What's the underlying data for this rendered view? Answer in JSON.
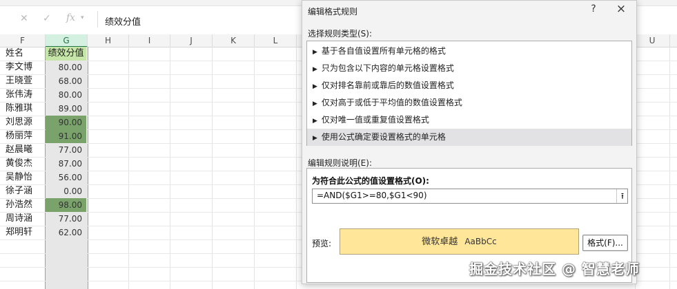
{
  "formula_bar": {
    "cancel_icon": "close-icon",
    "enter_icon": "check-icon",
    "fx_label": "fx",
    "content": "绩效分值"
  },
  "columns": {
    "left": [
      "F",
      "G",
      "H",
      "I",
      "J",
      "K",
      "L"
    ],
    "right": [
      "U"
    ]
  },
  "sheet": {
    "header_name": "姓名",
    "header_score": "绩效分值",
    "rows": [
      {
        "name": "李文博",
        "score": "80.00",
        "highlight": false
      },
      {
        "name": "王晓萱",
        "score": "68.00",
        "highlight": false
      },
      {
        "name": "张伟涛",
        "score": "80.00",
        "highlight": false
      },
      {
        "name": "陈雅琪",
        "score": "89.00",
        "highlight": false
      },
      {
        "name": "刘思源",
        "score": "90.00",
        "highlight": true
      },
      {
        "name": "杨丽萍",
        "score": "91.00",
        "highlight": true
      },
      {
        "name": "赵晨曦",
        "score": "77.00",
        "highlight": false
      },
      {
        "name": "黄俊杰",
        "score": "87.00",
        "highlight": false
      },
      {
        "name": "吴静怡",
        "score": "56.00",
        "highlight": false
      },
      {
        "name": "徐子涵",
        "score": "0.00",
        "highlight": false
      },
      {
        "name": "孙浩然",
        "score": "98.00",
        "highlight": true
      },
      {
        "name": "周诗涵",
        "score": "77.00",
        "highlight": false
      },
      {
        "name": "郑明轩",
        "score": "62.00",
        "highlight": false
      }
    ]
  },
  "dialog": {
    "title": "编辑格式规则",
    "help": "?",
    "close": "×",
    "rule_type_label": "选择规则类型(S):",
    "rule_types": [
      "基于各自值设置所有单元格的格式",
      "只为包含以下内容的单元格设置格式",
      "仅对排名靠前或靠后的数值设置格式",
      "仅对高于或低于平均值的数值设置格式",
      "仅对唯一值或重复值设置格式",
      "使用公式确定要设置格式的单元格"
    ],
    "selected_rule_index": 5,
    "description_label": "编辑规则说明(E):",
    "formula_label": "为符合此公式的值设置格式(O):",
    "formula_value": "=AND($G1>=80,$G1<90)",
    "collapse_icon": "collapse-dialog-icon",
    "preview_label": "预览:",
    "preview_text": "微软卓越",
    "preview_sample": "AaBbCc",
    "preview_fill_color": "#ffe699",
    "format_button": "格式(F)..."
  },
  "watermark": "掘金技术社区 @ 智慧老师",
  "colors": {
    "highlight_fill": "#7aa36b",
    "header_fill": "#c5e6a8",
    "selected_column": "#217346"
  }
}
